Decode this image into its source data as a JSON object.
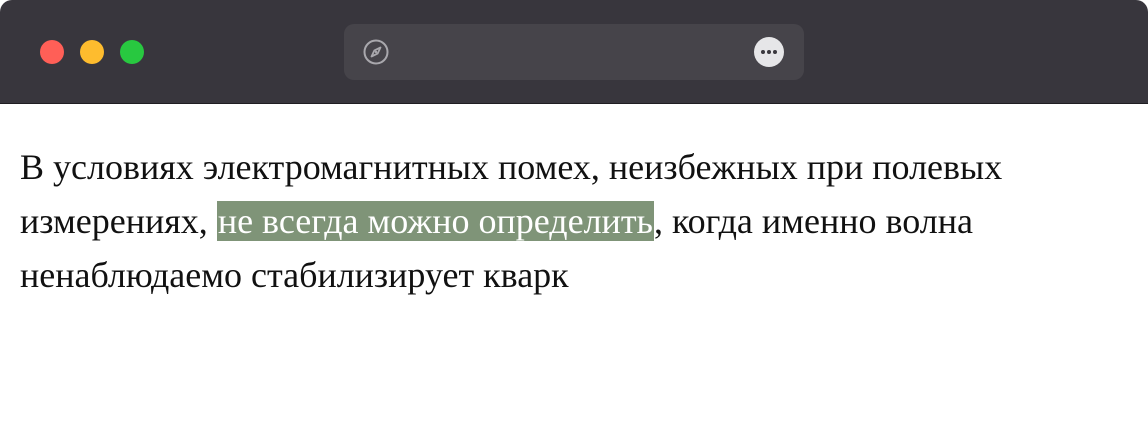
{
  "window": {
    "buttons": {
      "close_color": "#ff5f57",
      "minimize_color": "#febc2e",
      "maximize_color": "#28c840"
    }
  },
  "toolbar": {
    "address_icon": "compass-icon",
    "more_icon": "more-options-icon"
  },
  "content": {
    "text_before": "В условиях электромагнитных помех, неизбежных при полевых измерениях, ",
    "highlighted_text": "не всегда можно определить",
    "text_after": ", когда именно волна ненаблюдаемо стабилизирует кварк",
    "highlight_color": "#7f9478"
  }
}
